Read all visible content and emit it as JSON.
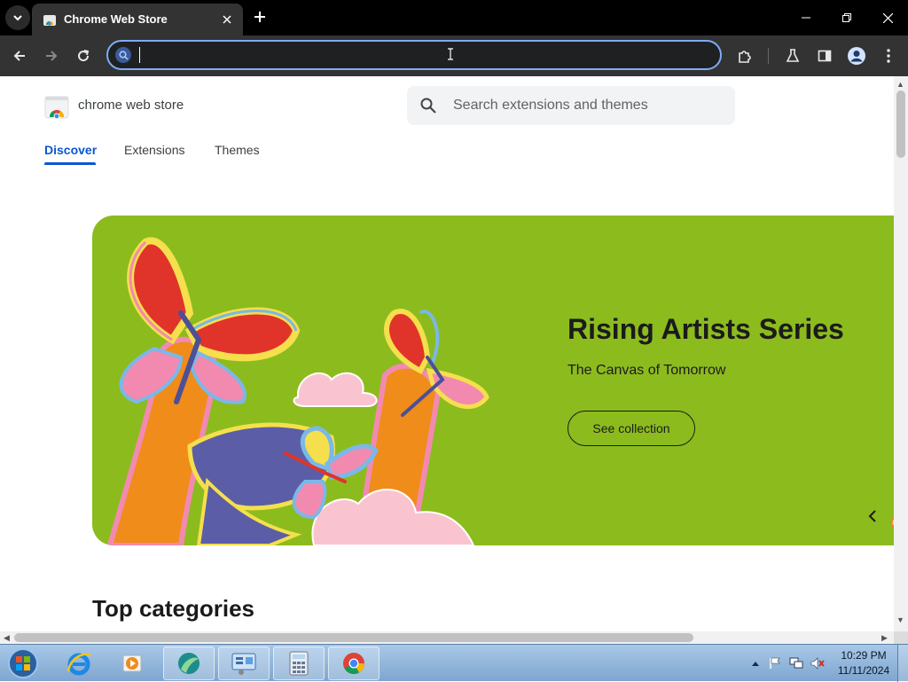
{
  "browser": {
    "tab": {
      "title": "Chrome Web Store"
    },
    "omnibox": {
      "value": "",
      "placeholder": ""
    }
  },
  "store": {
    "name": "chrome web store",
    "search_placeholder": "Search extensions and themes",
    "nav": {
      "discover": "Discover",
      "extensions": "Extensions",
      "themes": "Themes"
    },
    "hero": {
      "title": "Rising Artists Series",
      "subtitle": "The Canvas of Tomorrow",
      "button": "See collection"
    },
    "top_categories": "Top categories"
  },
  "taskbar": {
    "clock_time": "10:29 PM",
    "clock_date": "11/11/2024"
  },
  "colors": {
    "hero_bg": "#8cbb1e",
    "accent": "#0b57d0",
    "tab_bg": "#333333",
    "omnibox_focus": "#7cacf8"
  },
  "icons": {
    "tab_favicon": "chrome-web-store-icon",
    "omnibox": "search-icon",
    "extensions": "puzzle-icon",
    "labs": "flask-icon",
    "side_panel": "side-panel-icon",
    "profile": "profile-icon",
    "menu": "kebab-menu-icon"
  }
}
